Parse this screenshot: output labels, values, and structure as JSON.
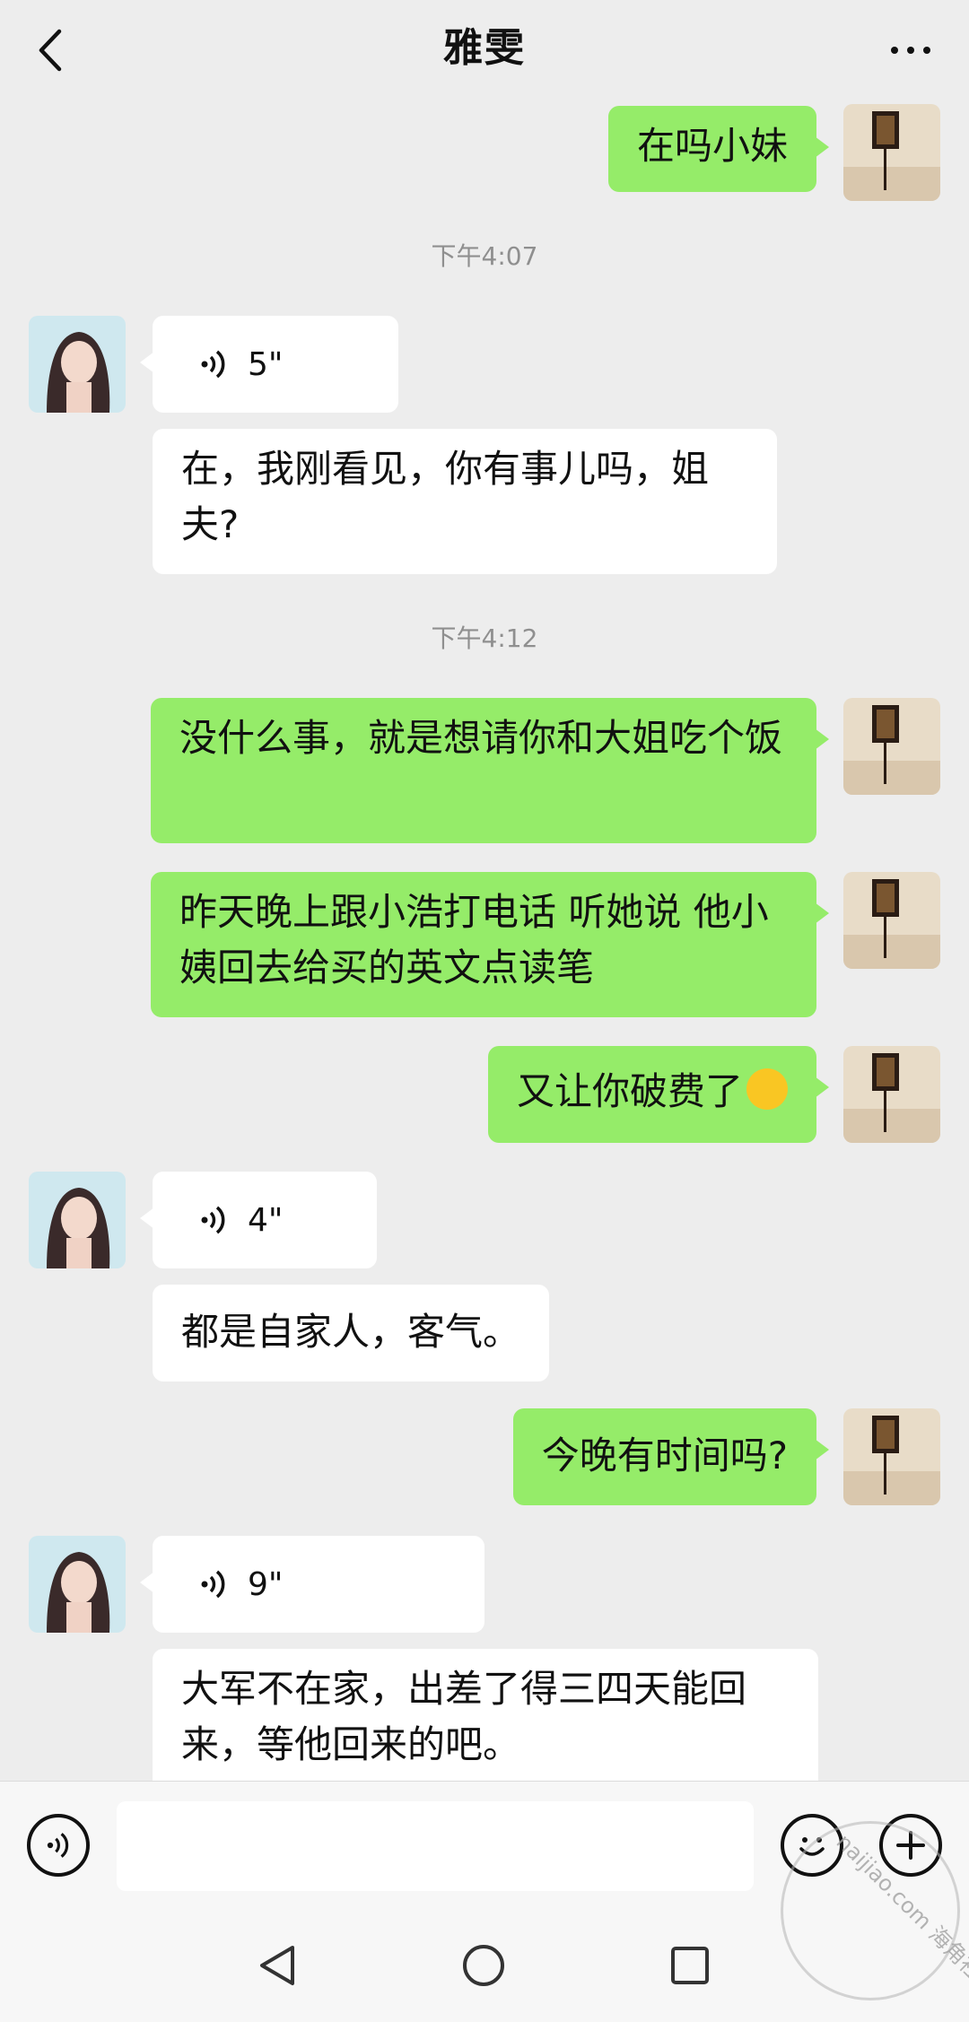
{
  "header": {
    "title": "雅雯"
  },
  "messages": {
    "m1": "在吗小妹",
    "ts1": "下午4:07",
    "v1": "5\"",
    "m2": "在，我刚看见，你有事儿吗，姐夫?",
    "ts2": "下午4:12",
    "m3": "没什么事，就是想请你和大姐吃个饭",
    "m4": "昨天晚上跟小浩打电话 听她说 他小姨回去给买的英文点读笔",
    "m5": "又让你破费了",
    "v2": "4\"",
    "m6": "都是自家人，客气。",
    "m7": "今晚有时间吗?",
    "v3": "9\"",
    "m8": "大军不在家，出差了得三四天能回来，等他回来的吧。"
  },
  "input": {
    "placeholder": ""
  },
  "watermark": {
    "text": "naijiao.com 海角社区"
  },
  "colors": {
    "sent": "#95ec69",
    "received": "#ffffff",
    "background": "#ededed"
  },
  "icons": [
    "back-icon",
    "more-icon",
    "voice-wave-icon",
    "emoji-icon",
    "plus-icon",
    "nav-back-icon",
    "nav-home-icon",
    "nav-recents-icon"
  ]
}
